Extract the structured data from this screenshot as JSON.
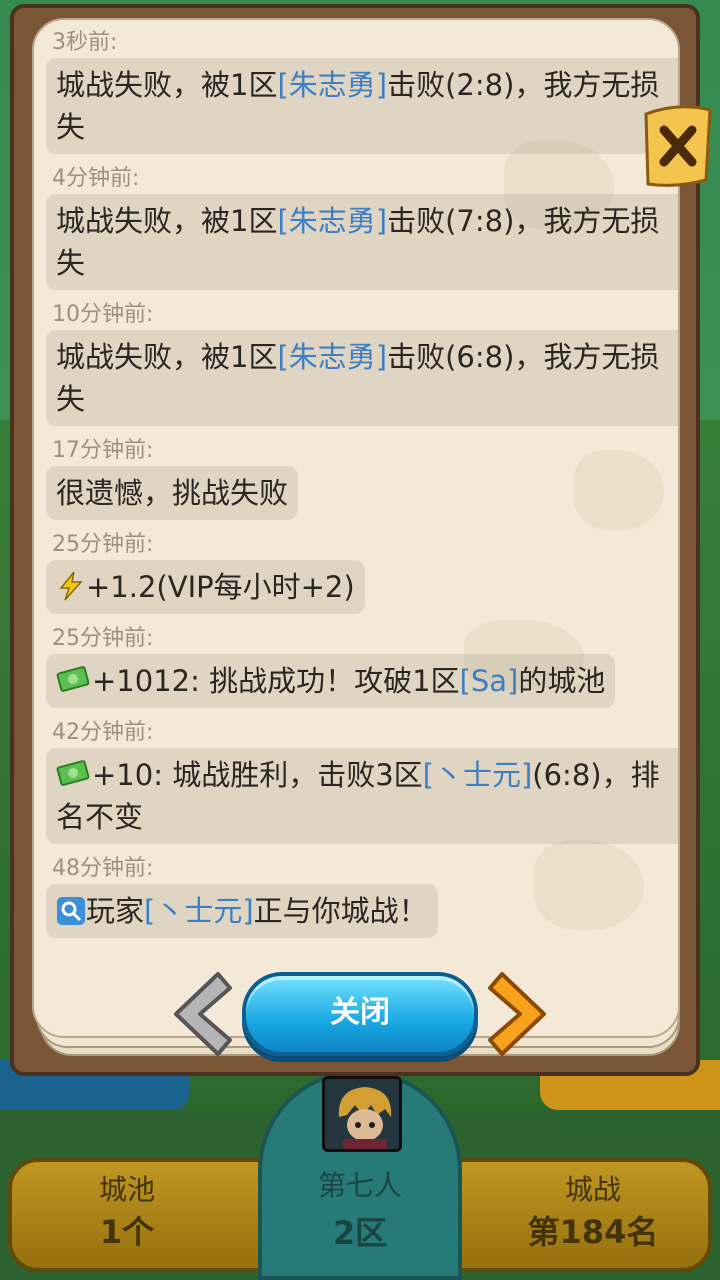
{
  "dialog": {
    "close_button_label": "关闭",
    "entries": [
      {
        "time": "3秒前:",
        "pre": "城战失败，被1区",
        "link": "[朱志勇]",
        "post": "击败(2:8)，我方无损失"
      },
      {
        "time": "4分钟前:",
        "pre": "城战失败，被1区",
        "link": "[朱志勇]",
        "post": "击败(7:8)，我方无损失"
      },
      {
        "time": "10分钟前:",
        "pre": "城战失败，被1区",
        "link": "[朱志勇]",
        "post": "击败(6:8)，我方无损失"
      },
      {
        "time": "17分钟前:",
        "text": "很遗憾，挑战失败"
      },
      {
        "time": "25分钟前:",
        "text": "+1.2(VIP每小时+2)",
        "icon": "lightning-bolt-icon"
      },
      {
        "time": "25分钟前:",
        "pre": "+1012: 挑战成功！攻破1区",
        "link": "[Sa]",
        "post": "的城池",
        "icon": "cash-icon"
      },
      {
        "time": "42分钟前:",
        "pre": "+10: 城战胜利，击败3区",
        "link": "[丶士元]",
        "post": "(6:8)，排名不变",
        "icon": "cash-icon"
      },
      {
        "time": "48分钟前:",
        "pre": "玩家",
        "link": "[丶士元]",
        "post": "正与你城战！",
        "icon": "search-icon"
      }
    ]
  },
  "status_bar": {
    "cities": {
      "title": "城池",
      "value": "1个"
    },
    "player": {
      "name": "第七人",
      "server": "2区"
    },
    "city_war": {
      "title": "城战",
      "value": "第184名"
    }
  },
  "colors": {
    "link": "#3e7fc4",
    "close_button": "#18a8e2",
    "frame": "#7a5636",
    "paper": "#f4e9d6"
  }
}
